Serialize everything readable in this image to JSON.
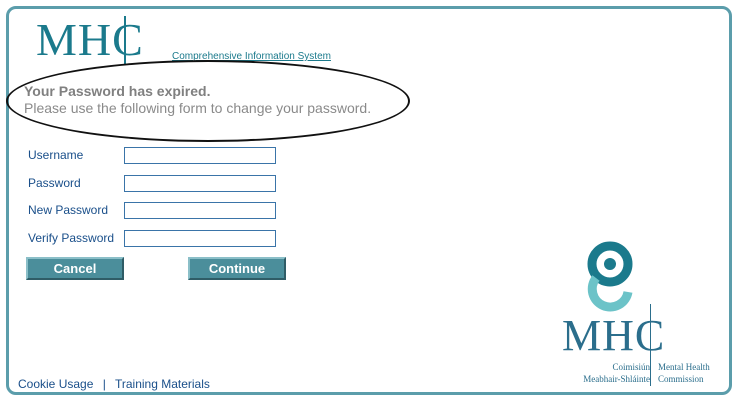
{
  "header": {
    "logo_text": "MHC",
    "tagline": "Comprehensive Information System"
  },
  "message": {
    "title": "Your Password has expired.",
    "subtitle": "Please use the following form to change your password."
  },
  "form": {
    "fields": [
      {
        "label": "Username",
        "value": ""
      },
      {
        "label": "Password",
        "value": ""
      },
      {
        "label": "New Password",
        "value": ""
      },
      {
        "label": "Verify Password",
        "value": ""
      }
    ],
    "cancel_label": "Cancel",
    "continue_label": "Continue"
  },
  "brand": {
    "mhc": "MHC",
    "left_line1": "Coimisiún",
    "left_line2": "Meabhair-Shláinte",
    "right_line1": "Mental Health",
    "right_line2": "Commission"
  },
  "footer": {
    "links": [
      "Cookie Usage",
      "Training Materials"
    ],
    "separator": "|"
  },
  "colors": {
    "frame": "#5b9dab",
    "accent": "#1b7a8c",
    "button": "#4b8e9b",
    "label": "#1a4f8a"
  }
}
